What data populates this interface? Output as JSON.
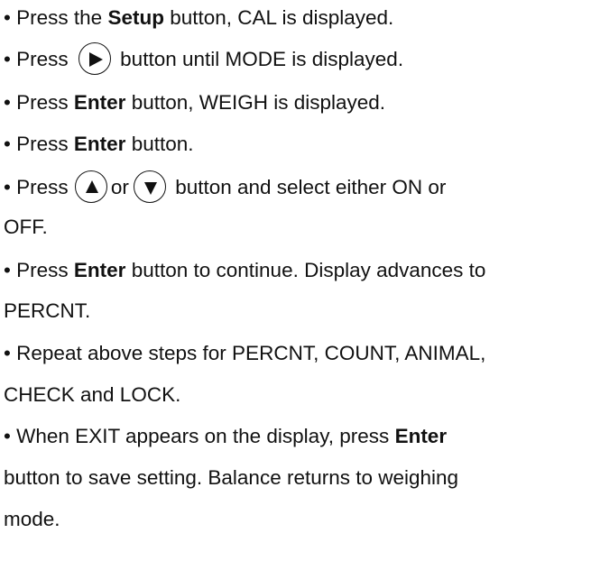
{
  "bullet_char": "•",
  "steps": [
    {
      "pre": "Press the ",
      "bold": "Setup",
      "post": " button, CAL is displayed."
    },
    {
      "pre": "Press ",
      "icon": "right-arrow-icon",
      "post": " button until MODE is displayed."
    },
    {
      "pre": "Press ",
      "bold": "Enter",
      "post": " button, WEIGH is displayed."
    },
    {
      "pre": "Press ",
      "bold": "Enter",
      "post": " button."
    },
    {
      "pre": "Press ",
      "icon1": "up-arrow-icon",
      "mid": "or",
      "icon2": "down-arrow-icon",
      "post_line1": " button and select either ON or",
      "post_line2": "OFF."
    },
    {
      "pre": "Press ",
      "bold": "Enter",
      "post_line1": " button to continue.  Display advances to",
      "post_line2": "PERCNT."
    },
    {
      "line1": "Repeat above steps for  PERCNT, COUNT,   ANIMAL,",
      "line2": "CHECK and LOCK."
    },
    {
      "pre": "When EXIT appears on the display, press ",
      "bold": "Enter",
      "line2": "button to save setting.  Balance returns to weighing",
      "line3": "mode."
    }
  ]
}
